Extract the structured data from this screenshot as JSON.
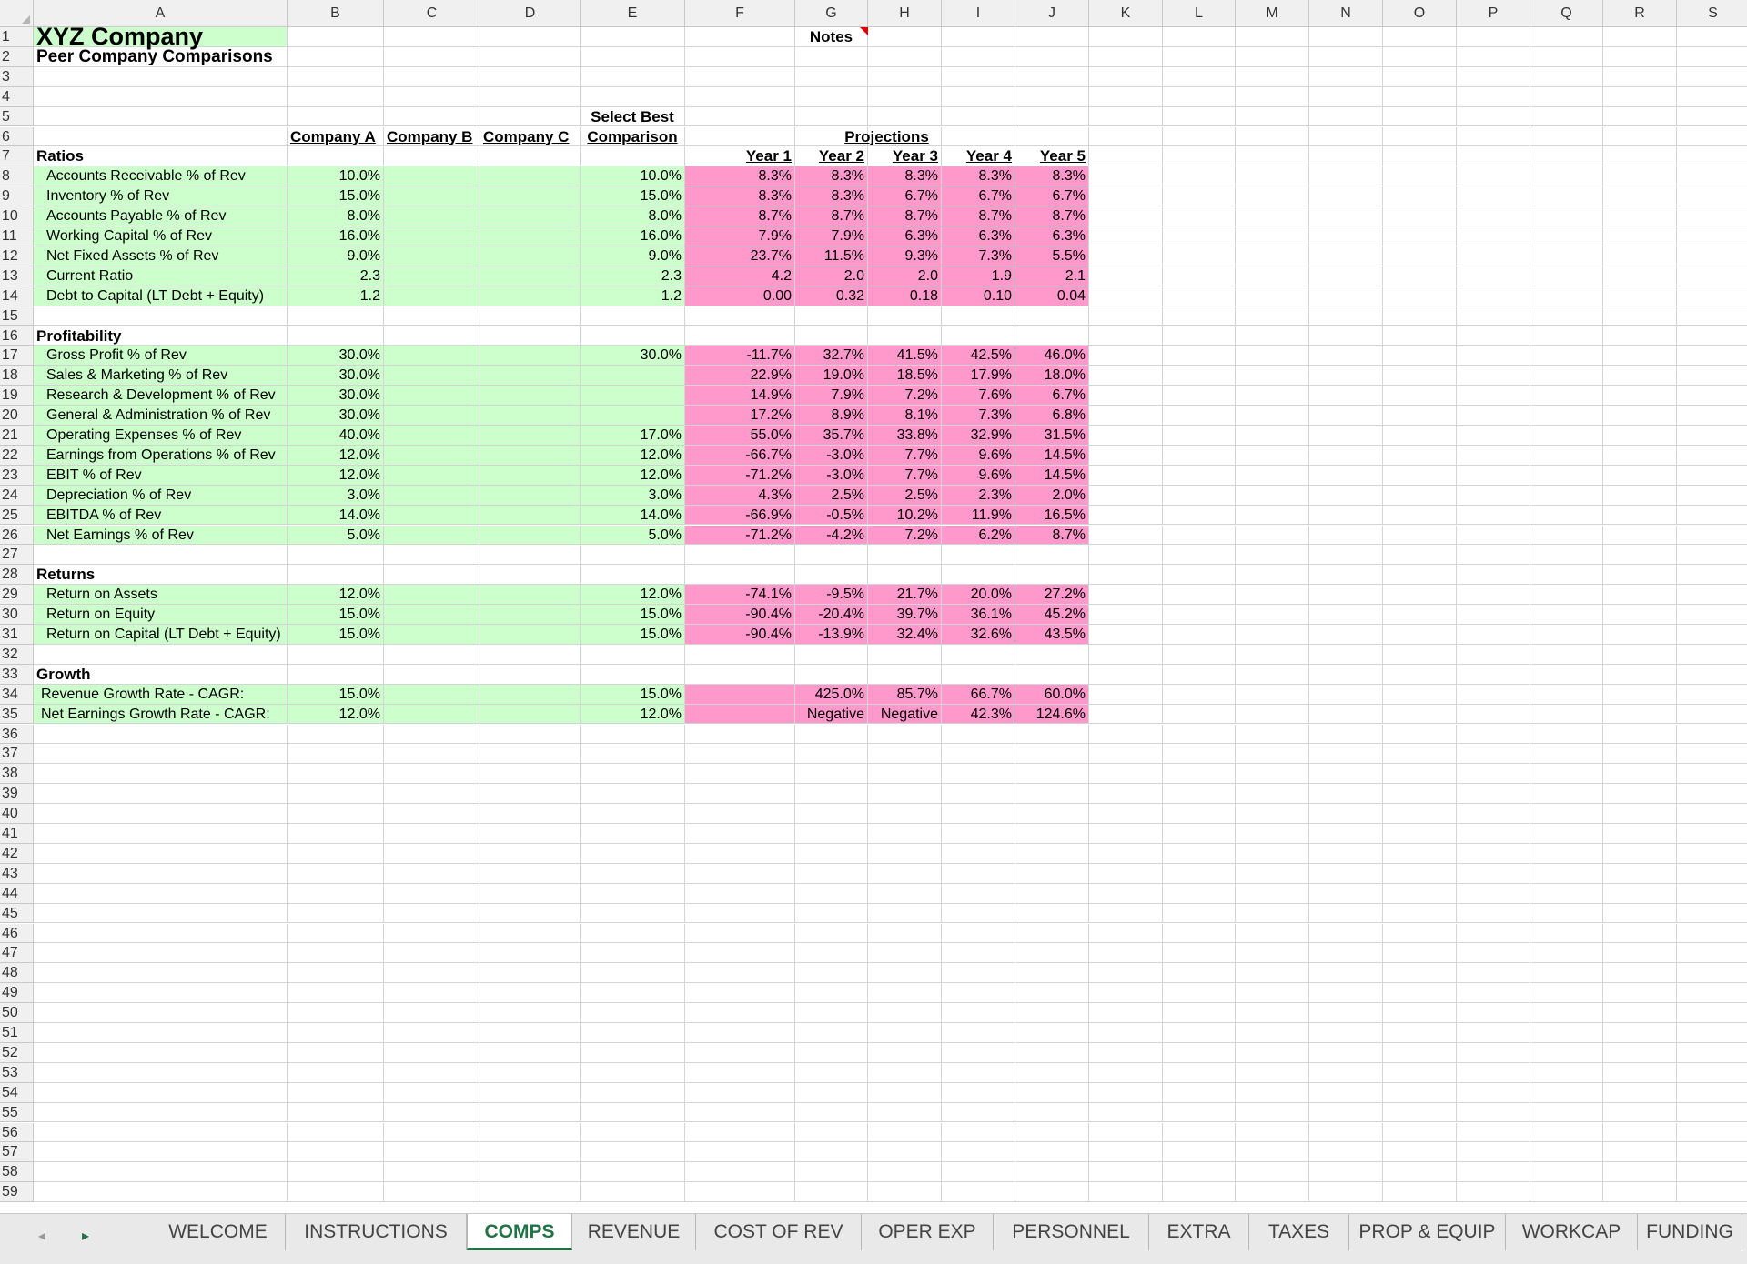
{
  "columns": [
    "A",
    "B",
    "C",
    "D",
    "E",
    "F",
    "G",
    "H",
    "I",
    "J",
    "K",
    "L",
    "M",
    "N",
    "O",
    "P",
    "Q",
    "R",
    "S"
  ],
  "sheet": {
    "title": "XYZ Company",
    "subtitle": "Peer Company Comparisons",
    "notes_label": "Notes",
    "select_best_line1": "Select Best",
    "select_best_line2": "Comparison",
    "companies": [
      "Company A",
      "Company B",
      "Company C"
    ],
    "projections_label": "Projections",
    "years": [
      "Year 1",
      "Year 2",
      "Year 3",
      "Year 4",
      "Year 5"
    ],
    "sections": [
      {
        "row": 7,
        "title": "Ratios",
        "items": [
          {
            "row": 8,
            "label": "Accounts Receivable % of Rev",
            "a": "10.0%",
            "best": "10.0%",
            "proj": [
              "8.3%",
              "8.3%",
              "8.3%",
              "8.3%",
              "8.3%"
            ]
          },
          {
            "row": 9,
            "label": "Inventory % of Rev",
            "a": "15.0%",
            "best": "15.0%",
            "proj": [
              "8.3%",
              "8.3%",
              "6.7%",
              "6.7%",
              "6.7%"
            ]
          },
          {
            "row": 10,
            "label": "Accounts Payable % of Rev",
            "a": "8.0%",
            "best": "8.0%",
            "proj": [
              "8.7%",
              "8.7%",
              "8.7%",
              "8.7%",
              "8.7%"
            ]
          },
          {
            "row": 11,
            "label": "Working Capital % of Rev",
            "a": "16.0%",
            "best": "16.0%",
            "proj": [
              "7.9%",
              "7.9%",
              "6.3%",
              "6.3%",
              "6.3%"
            ]
          },
          {
            "row": 12,
            "label": "Net Fixed Assets % of Rev",
            "a": "9.0%",
            "best": "9.0%",
            "proj": [
              "23.7%",
              "11.5%",
              "9.3%",
              "7.3%",
              "5.5%"
            ]
          },
          {
            "row": 13,
            "label": "Current Ratio",
            "a": "2.3",
            "best": "2.3",
            "proj": [
              "4.2",
              "2.0",
              "2.0",
              "1.9",
              "2.1"
            ]
          },
          {
            "row": 14,
            "label": "Debt to Capital (LT Debt + Equity)",
            "a": "1.2",
            "best": "1.2",
            "proj": [
              "0.00",
              "0.32",
              "0.18",
              "0.10",
              "0.04"
            ]
          }
        ]
      },
      {
        "row": 16,
        "title": "Profitability",
        "items": [
          {
            "row": 17,
            "label": "Gross Profit % of Rev",
            "a": "30.0%",
            "best": "30.0%",
            "proj": [
              "-11.7%",
              "32.7%",
              "41.5%",
              "42.5%",
              "46.0%"
            ]
          },
          {
            "row": 18,
            "label": "Sales & Marketing % of Rev",
            "a": "30.0%",
            "best": "",
            "proj": [
              "22.9%",
              "19.0%",
              "18.5%",
              "17.9%",
              "18.0%"
            ]
          },
          {
            "row": 19,
            "label": "Research & Development % of Rev",
            "a": "30.0%",
            "best": "",
            "proj": [
              "14.9%",
              "7.9%",
              "7.2%",
              "7.6%",
              "6.7%"
            ]
          },
          {
            "row": 20,
            "label": "General & Administration % of Rev",
            "a": "30.0%",
            "best": "",
            "proj": [
              "17.2%",
              "8.9%",
              "8.1%",
              "7.3%",
              "6.8%"
            ]
          },
          {
            "row": 21,
            "label": "Operating Expenses % of Rev",
            "a": "40.0%",
            "best": "17.0%",
            "proj": [
              "55.0%",
              "35.7%",
              "33.8%",
              "32.9%",
              "31.5%"
            ]
          },
          {
            "row": 22,
            "label": "Earnings from Operations % of Rev",
            "a": "12.0%",
            "best": "12.0%",
            "proj": [
              "-66.7%",
              "-3.0%",
              "7.7%",
              "9.6%",
              "14.5%"
            ]
          },
          {
            "row": 23,
            "label": "EBIT % of Rev",
            "a": "12.0%",
            "best": "12.0%",
            "proj": [
              "-71.2%",
              "-3.0%",
              "7.7%",
              "9.6%",
              "14.5%"
            ]
          },
          {
            "row": 24,
            "label": "Depreciation % of Rev",
            "a": "3.0%",
            "best": "3.0%",
            "proj": [
              "4.3%",
              "2.5%",
              "2.5%",
              "2.3%",
              "2.0%"
            ]
          },
          {
            "row": 25,
            "label": "EBITDA % of Rev",
            "a": "14.0%",
            "best": "14.0%",
            "proj": [
              "-66.9%",
              "-0.5%",
              "10.2%",
              "11.9%",
              "16.5%"
            ]
          },
          {
            "row": 26,
            "label": "Net Earnings % of Rev",
            "a": "5.0%",
            "best": "5.0%",
            "proj": [
              "-71.2%",
              "-4.2%",
              "7.2%",
              "6.2%",
              "8.7%"
            ]
          }
        ]
      },
      {
        "row": 28,
        "title": "Returns",
        "items": [
          {
            "row": 29,
            "label": "Return on Assets",
            "a": "12.0%",
            "best": "12.0%",
            "proj": [
              "-74.1%",
              "-9.5%",
              "21.7%",
              "20.0%",
              "27.2%"
            ]
          },
          {
            "row": 30,
            "label": "Return on Equity",
            "a": "15.0%",
            "best": "15.0%",
            "proj": [
              "-90.4%",
              "-20.4%",
              "39.7%",
              "36.1%",
              "45.2%"
            ]
          },
          {
            "row": 31,
            "label": "Return on Capital (LT Debt + Equity)",
            "a": "15.0%",
            "best": "15.0%",
            "proj": [
              "-90.4%",
              "-13.9%",
              "32.4%",
              "32.6%",
              "43.5%"
            ]
          }
        ]
      },
      {
        "row": 33,
        "title": "Growth",
        "items": [
          {
            "row": 34,
            "label": "Revenue Growth Rate - CAGR:",
            "a": "15.0%",
            "best": "15.0%",
            "proj": [
              "",
              "425.0%",
              "85.7%",
              "66.7%",
              "60.0%"
            ]
          },
          {
            "row": 35,
            "label": "Net Earnings Growth Rate - CAGR:",
            "a": "12.0%",
            "best": "12.0%",
            "proj": [
              "",
              "Negative",
              "Negative",
              "42.3%",
              "124.6%"
            ]
          }
        ]
      }
    ]
  },
  "tabs": [
    "WELCOME",
    "INSTRUCTIONS",
    "COMPS",
    "REVENUE",
    "COST OF REV",
    "OPER EXP",
    "PERSONNEL",
    "EXTRA",
    "TAXES",
    "PROP & EQUIP",
    "WORKCAP",
    "FUNDING"
  ],
  "active_tab": "COMPS",
  "colors": {
    "input_green": "#ccffcc",
    "projection_pink": "#ff99cc",
    "tab_accent": "#217346"
  }
}
